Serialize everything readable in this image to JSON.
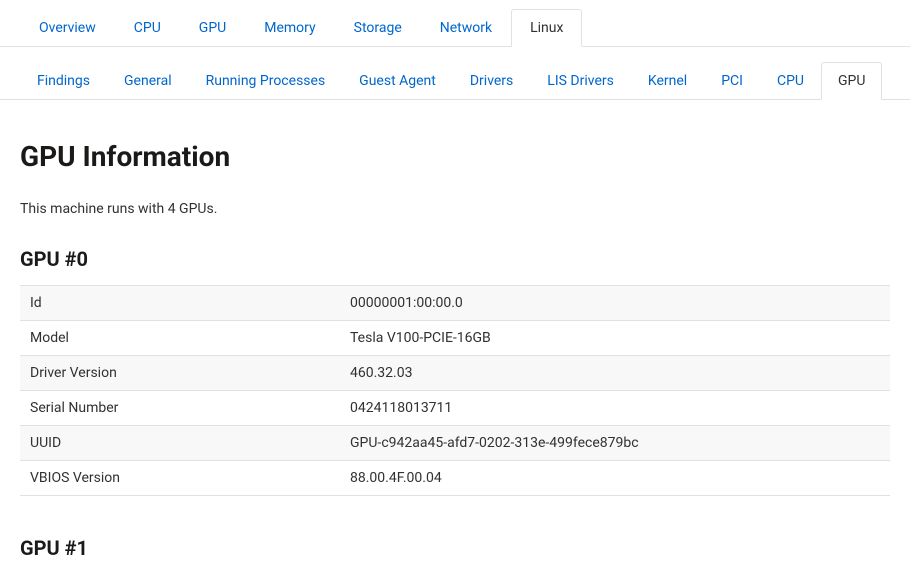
{
  "primaryTabs": {
    "items": [
      {
        "label": "Overview",
        "active": false
      },
      {
        "label": "CPU",
        "active": false
      },
      {
        "label": "GPU",
        "active": false
      },
      {
        "label": "Memory",
        "active": false
      },
      {
        "label": "Storage",
        "active": false
      },
      {
        "label": "Network",
        "active": false
      },
      {
        "label": "Linux",
        "active": true
      }
    ]
  },
  "secondaryTabs": {
    "items": [
      {
        "label": "Findings",
        "active": false
      },
      {
        "label": "General",
        "active": false
      },
      {
        "label": "Running Processes",
        "active": false
      },
      {
        "label": "Guest Agent",
        "active": false
      },
      {
        "label": "Drivers",
        "active": false
      },
      {
        "label": "LIS Drivers",
        "active": false
      },
      {
        "label": "Kernel",
        "active": false
      },
      {
        "label": "PCI",
        "active": false
      },
      {
        "label": "CPU",
        "active": false
      },
      {
        "label": "GPU",
        "active": true
      }
    ]
  },
  "page": {
    "title": "GPU Information",
    "subtitle": "This machine runs with 4 GPUs."
  },
  "gpu0": {
    "heading": "GPU #0",
    "rows": [
      {
        "label": "Id",
        "value": "00000001:00:00.0"
      },
      {
        "label": "Model",
        "value": "Tesla V100-PCIE-16GB"
      },
      {
        "label": "Driver Version",
        "value": "460.32.03"
      },
      {
        "label": "Serial Number",
        "value": "0424118013711"
      },
      {
        "label": "UUID",
        "value": "GPU-c942aa45-afd7-0202-313e-499fece879bc"
      },
      {
        "label": "VBIOS Version",
        "value": "88.00.4F.00.04"
      }
    ]
  },
  "gpu1": {
    "heading": "GPU #1"
  }
}
